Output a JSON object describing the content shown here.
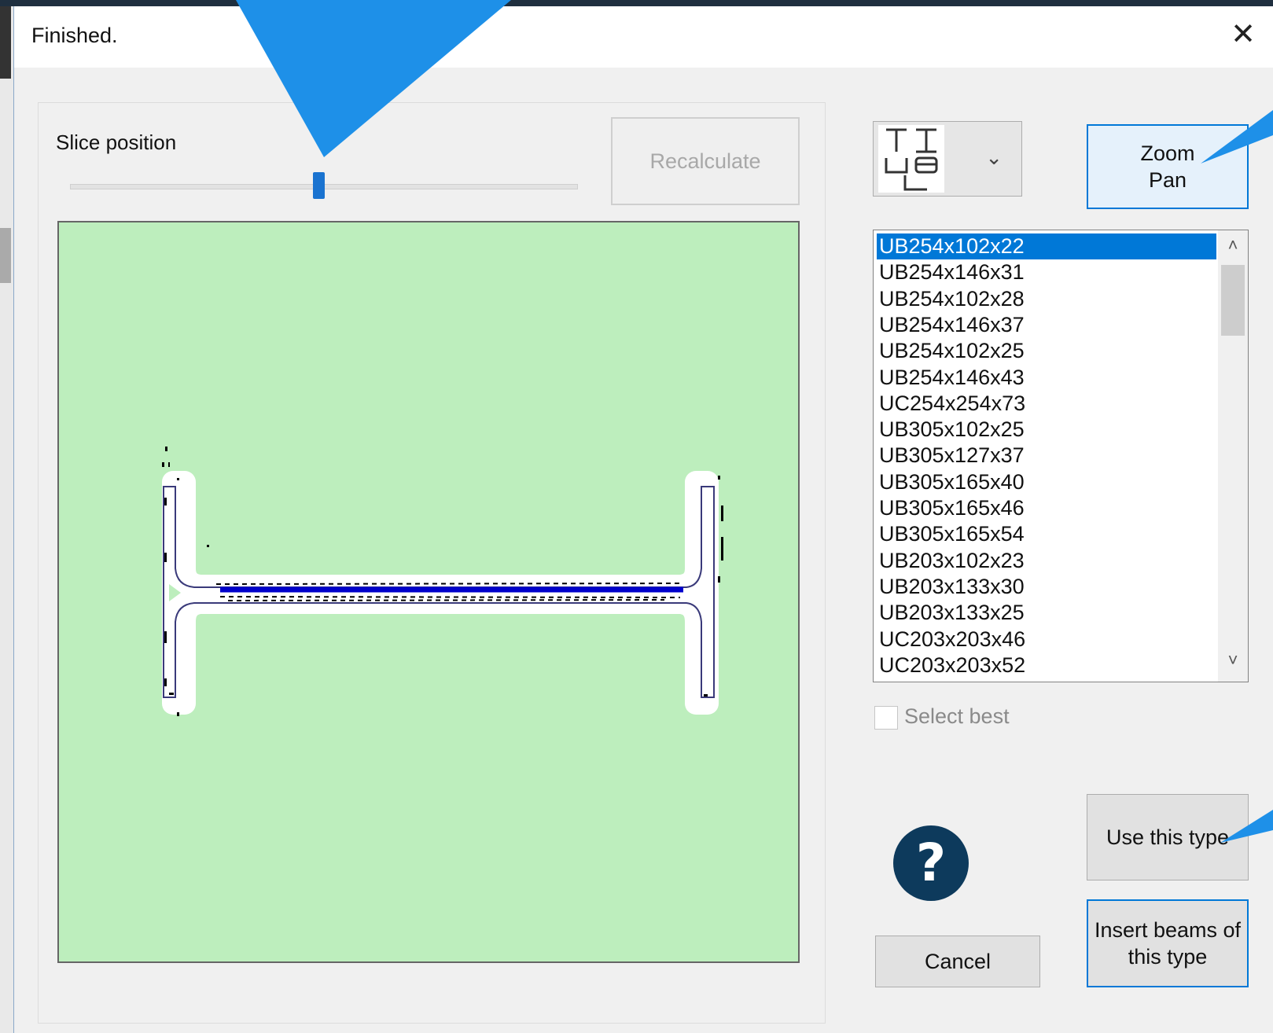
{
  "dialog": {
    "title": "Finished.",
    "close_glyph": "✕"
  },
  "slice": {
    "label": "Slice position",
    "value_fraction": 0.49
  },
  "buttons": {
    "recalculate": "Recalculate",
    "zoom_line1": "Zoom",
    "zoom_line2": "Pan",
    "use_type": "Use this type",
    "cancel": "Cancel",
    "insert_line1": "Insert beams of",
    "insert_line2": "this type"
  },
  "section_dropdown": {
    "icon": "section-type-icon",
    "chevron": "⌄"
  },
  "beam_list": {
    "selected_index": 0,
    "items": [
      "UB254x102x22",
      "UB254x146x31",
      "UB254x102x28",
      "UB254x146x37",
      "UB254x102x25",
      "UB254x146x43",
      "UC254x254x73",
      "UB305x102x25",
      "UB305x127x37",
      "UB305x165x40",
      "UB305x165x46",
      "UB305x165x54",
      "UB203x102x23",
      "UB203x133x30",
      "UB203x133x25",
      "UC203x203x46",
      "UC203x203x52"
    ],
    "scroll_up": "˄",
    "scroll_down": "˅"
  },
  "select_best": {
    "label": "Select best",
    "checked": false
  },
  "help": {
    "glyph": "?"
  },
  "colors": {
    "canvas_bg": "#bdeebd",
    "accent": "#0078d7",
    "callout": "#1e90e8",
    "help_bg": "#0d3a5c",
    "profile_line": "#0000cc"
  }
}
